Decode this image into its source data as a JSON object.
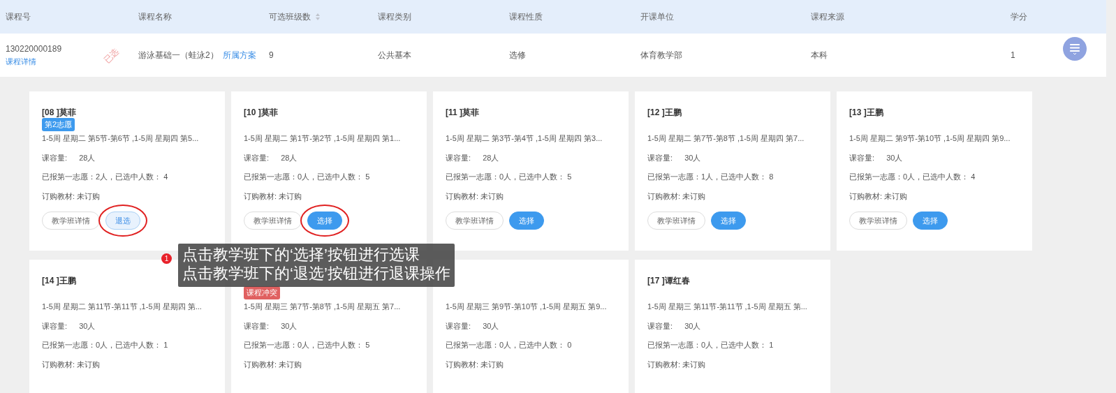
{
  "table": {
    "columns": [
      {
        "label": "课程号",
        "sortable": false
      },
      {
        "label": "课程名称",
        "sortable": false
      },
      {
        "label": "可选班级数",
        "sortable": true
      },
      {
        "label": "课程类别",
        "sortable": false
      },
      {
        "label": "课程性质",
        "sortable": false
      },
      {
        "label": "开课单位",
        "sortable": false
      },
      {
        "label": "课程来源",
        "sortable": false
      },
      {
        "label": "学分",
        "sortable": false
      }
    ],
    "row": {
      "code": "130220000189",
      "detail_link": "课程详情",
      "stamp": "已选",
      "name": "游泳基础一（蛙泳2）",
      "plan_link": "所属方案",
      "class_count": "9",
      "category": "公共基本",
      "nature": "选修",
      "department": "体育教学部",
      "source": "本科",
      "credits": "1"
    }
  },
  "cards": [
    {
      "title": "[08 ]莫菲",
      "badge": {
        "text": "第2志愿",
        "kind": "preference"
      },
      "schedule": "1-5周 星期二 第5节-第6节 ,1-5周 星期四 第5...",
      "capacity_label": "课容量:",
      "capacity": "28人",
      "signup": "已报第一志愿：2人，已选中人数： 4",
      "textbook": "订购教材: 未订购",
      "buttons": [
        {
          "label": "教学班详情",
          "kind": "outline",
          "highlighted": false
        },
        {
          "label": "退选",
          "kind": "withdraw",
          "highlighted": true
        }
      ]
    },
    {
      "title": "[10 ]莫菲",
      "schedule": "1-5周 星期二 第1节-第2节 ,1-5周 星期四 第1...",
      "capacity_label": "课容量:",
      "capacity": "28人",
      "signup": "已报第一志愿：0人，已选中人数： 5",
      "textbook": "订购教材: 未订购",
      "buttons": [
        {
          "label": "教学班详情",
          "kind": "outline",
          "highlighted": false
        },
        {
          "label": "选择",
          "kind": "primary",
          "highlighted": true
        }
      ]
    },
    {
      "title": "[11 ]莫菲",
      "schedule": "1-5周 星期二 第3节-第4节 ,1-5周 星期四 第3...",
      "capacity_label": "课容量:",
      "capacity": "28人",
      "signup": "已报第一志愿：0人，已选中人数： 5",
      "textbook": "订购教材: 未订购",
      "buttons": [
        {
          "label": "教学班详情",
          "kind": "outline",
          "highlighted": false
        },
        {
          "label": "选择",
          "kind": "primary",
          "highlighted": false
        }
      ]
    },
    {
      "title": "[12 ]王鹏",
      "schedule": "1-5周 星期二 第7节-第8节 ,1-5周 星期四 第7...",
      "capacity_label": "课容量:",
      "capacity": "30人",
      "signup": "已报第一志愿：1人，已选中人数： 8",
      "textbook": "订购教材: 未订购",
      "buttons": [
        {
          "label": "教学班详情",
          "kind": "outline",
          "highlighted": false
        },
        {
          "label": "选择",
          "kind": "primary",
          "highlighted": false
        }
      ]
    },
    {
      "title": "[13 ]王鹏",
      "schedule": "1-5周 星期二 第9节-第10节 ,1-5周 星期四 第9...",
      "capacity_label": "课容量:",
      "capacity": "30人",
      "signup": "已报第一志愿：0人，已选中人数： 4",
      "textbook": "订购教材: 未订购",
      "buttons": [
        {
          "label": "教学班详情",
          "kind": "outline",
          "highlighted": false
        },
        {
          "label": "选择",
          "kind": "primary",
          "highlighted": false
        }
      ]
    },
    {
      "title": "[14 ]王鹏",
      "schedule": "1-5周 星期二 第11节-第11节 ,1-5周 星期四 第...",
      "capacity_label": "课容量:",
      "capacity": "30人",
      "signup": "已报第一志愿：0人，已选中人数： 1",
      "textbook": "订购教材: 未订购"
    },
    {
      "badge": {
        "text": "课程冲突",
        "kind": "conflict"
      },
      "schedule": "1-5周 星期三 第7节-第8节 ,1-5周 星期五 第7...",
      "capacity_label": "课容量:",
      "capacity": "30人",
      "signup": "已报第一志愿：0人，已选中人数： 5",
      "textbook": "订购教材: 未订购"
    },
    {
      "schedule": "1-5周 星期三 第9节-第10节 ,1-5周 星期五 第9...",
      "capacity_label": "课容量:",
      "capacity": "30人",
      "signup": "已报第一志愿：0人，已选中人数： 0",
      "textbook": "订购教材: 未订购"
    },
    {
      "title": "[17 ]谭红春",
      "schedule": "1-5周 星期三 第11节-第11节 ,1-5周 星期五 第...",
      "capacity_label": "课容量:",
      "capacity": "30人",
      "signup": "已报第一志愿：0人，已选中人数： 1",
      "textbook": "订购教材: 未订购"
    }
  ],
  "tooltip": {
    "step": "1",
    "lines": [
      "点击教学班下的‘选择’按钮进行选课",
      "点击教学班下的‘退选’按钮进行退课操作"
    ]
  }
}
